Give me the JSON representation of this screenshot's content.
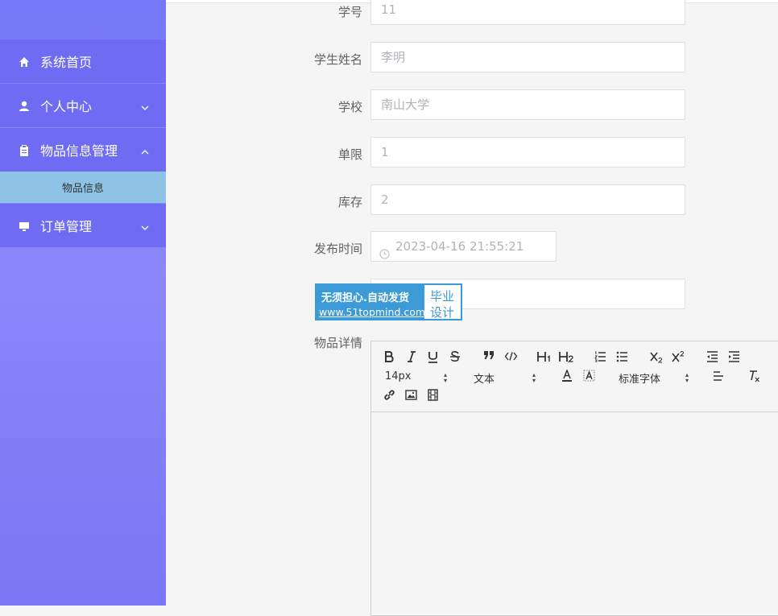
{
  "sidebar": {
    "items": [
      {
        "label": "系统首页"
      },
      {
        "label": "个人中心"
      },
      {
        "label": "物品信息管理"
      },
      {
        "label": "订单管理"
      }
    ],
    "submenu": {
      "label": "物品信息"
    }
  },
  "form": {
    "fields": [
      {
        "label": "学号",
        "value": "11"
      },
      {
        "label": "学生姓名",
        "value": "李明"
      },
      {
        "label": "学校",
        "value": "南山大学"
      },
      {
        "label": "单限",
        "value": "1"
      },
      {
        "label": "库存",
        "value": "2"
      },
      {
        "label": "发布时间",
        "value": "2023-04-16 21:55:21"
      },
      {
        "label": "",
        "value": ""
      }
    ],
    "details_label": "物品详情"
  },
  "watermark": {
    "line1": "无须担心.自动发货",
    "line2": "www.51topmind.com",
    "right1": "毕业",
    "right2": "设计"
  },
  "editor": {
    "font_size": "14px",
    "text_style": "文本",
    "font_family": "标准字体"
  }
}
